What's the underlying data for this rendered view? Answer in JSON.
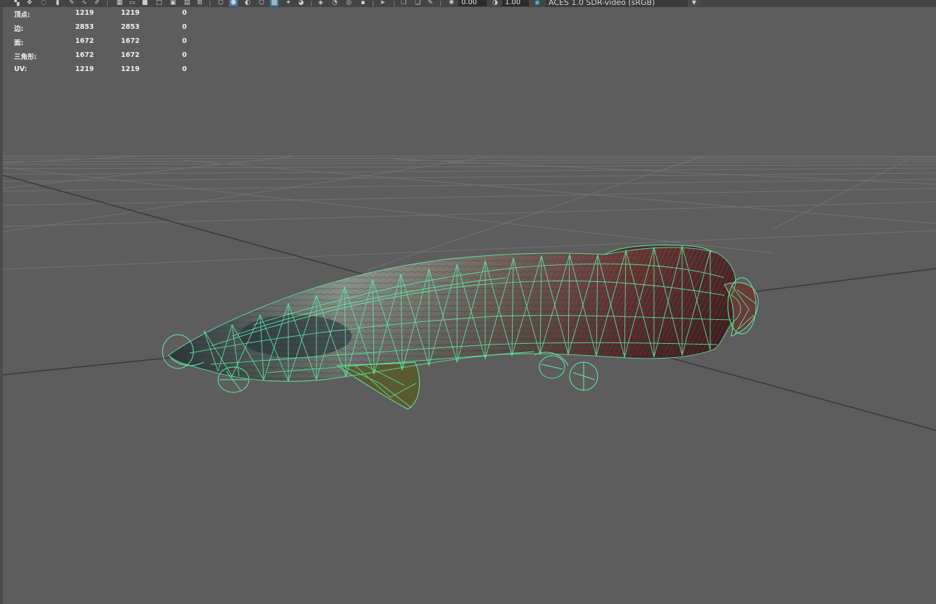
{
  "toolbar": {
    "exposure_value": "0.00",
    "gamma_value": "1.00",
    "view_transform": "ACES 1.0 SDR-video (sRGB)",
    "icons": [
      "select-icon",
      "move-icon",
      "lasso-icon",
      "paint-icon",
      "snap-icon",
      "grid-icon",
      "camera-icon",
      "film-gate-icon",
      "resolution-gate-icon",
      "wireframe-icon",
      "smooth-shade-icon",
      "textured-icon",
      "lights-icon",
      "shadows-icon",
      "xray-icon",
      "isolate-icon",
      "exposure-icon",
      "gamma-icon",
      "color-management-icon"
    ]
  },
  "heads_up_display": {
    "rows": [
      {
        "label": "顶点:",
        "v1": "1219",
        "v2": "1219",
        "v3": "0"
      },
      {
        "label": "边:",
        "v1": "2853",
        "v2": "2853",
        "v3": "0"
      },
      {
        "label": "面:",
        "v1": "1672",
        "v2": "1672",
        "v3": "0"
      },
      {
        "label": "三角形:",
        "v1": "1672",
        "v2": "1672",
        "v3": "0"
      },
      {
        "label": "UV:",
        "v1": "1219",
        "v2": "1219",
        "v3": "0"
      }
    ]
  },
  "viewport": {
    "background_color": "#5d5d5d",
    "grid_color": "#6e6e6e",
    "axis_color": "#3a3a3a",
    "wireframe_color": "#5cf2a8",
    "model": "arapaima-fish"
  }
}
